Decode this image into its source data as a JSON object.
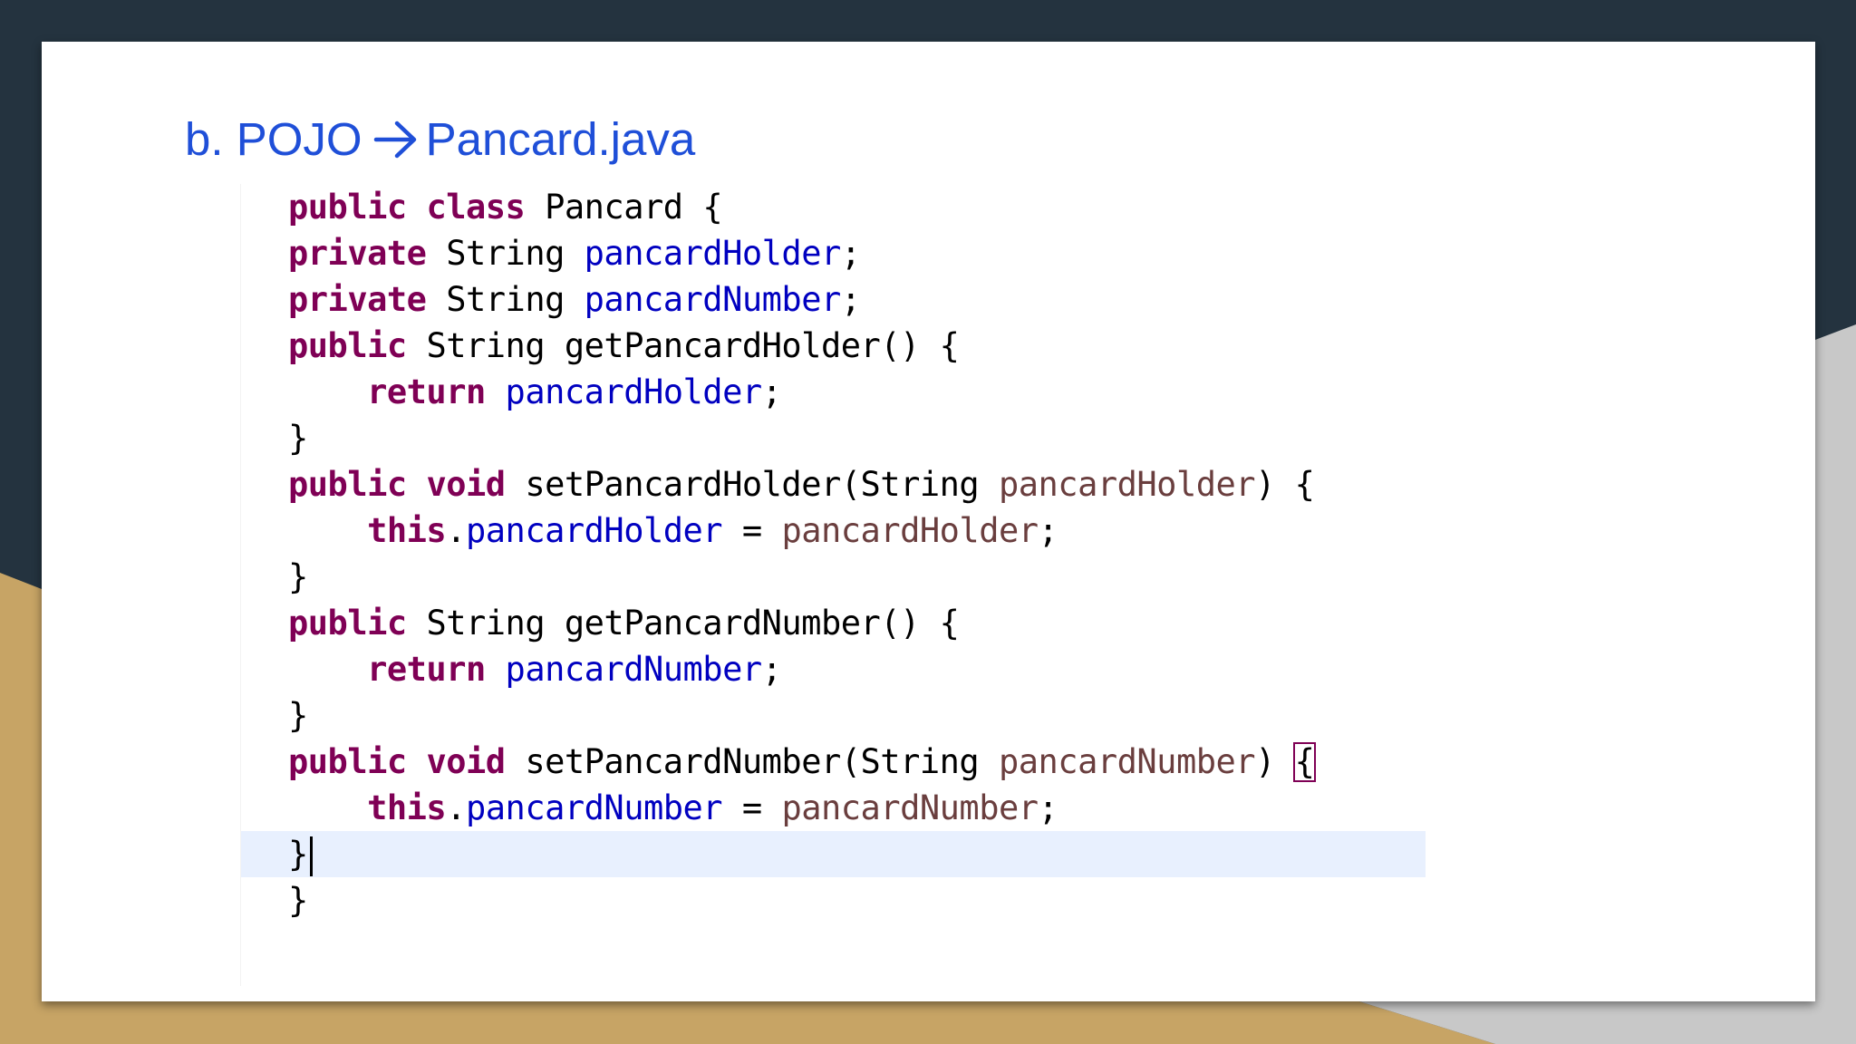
{
  "colors": {
    "background_dark": "#24333f",
    "background_gold": "#c7a465",
    "background_gray": "#c8c8c8",
    "title": "#1f4fd8",
    "keyword": "#7f0055",
    "field": "#0000c0",
    "parameter": "#6a3e3e",
    "current_line": "#e8f0fe"
  },
  "slide": {
    "title_prefix": "b. POJO",
    "title_suffix": "Pancard.java",
    "arrow_icon": "right-arrow-icon"
  },
  "code": {
    "lines": {
      "l1": {
        "kw1": "public",
        "kw2": "class",
        "rest": "Pancard {"
      },
      "l2": {
        "kw1": "private",
        "type": "String",
        "field": "pancardHolder",
        "end": ";"
      },
      "l3": {
        "kw1": "private",
        "type": "String",
        "field": "pancardNumber",
        "end": ";"
      },
      "l4": {
        "kw1": "public",
        "rest": "String getPancardHolder() {"
      },
      "l5": {
        "kw1": "return",
        "field": "pancardHolder",
        "end": ";"
      },
      "l6": {
        "rest": "}"
      },
      "l7": {
        "kw1": "public",
        "kw2": "void",
        "method": "setPancardHolder(String",
        "param": "pancardHolder",
        "end": ") {"
      },
      "l8": {
        "kw1": "this",
        "dot": ".",
        "field": "pancardHolder",
        "eq": "=",
        "param": "pancardHolder",
        "end": ";"
      },
      "l9": {
        "rest": "}"
      },
      "l10": {
        "kw1": "public",
        "rest": "String getPancardNumber() {"
      },
      "l11": {
        "kw1": "return",
        "field": "pancardNumber",
        "end": ";"
      },
      "l12": {
        "rest": "}"
      },
      "l13": {
        "kw1": "public",
        "kw2": "void",
        "method": "setPancardNumber(String",
        "param": "pancardNumber",
        "close": ")",
        "bracket": "{"
      },
      "l14": {
        "kw1": "this",
        "dot": ".",
        "field": "pancardNumber",
        "eq": "=",
        "param": "pancardNumber",
        "end": ";"
      },
      "l15": {
        "rest": "}"
      },
      "l16": {
        "rest": "}"
      }
    }
  }
}
